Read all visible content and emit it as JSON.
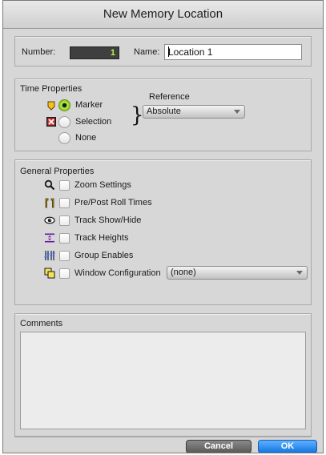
{
  "window": {
    "title": "New Memory Location"
  },
  "header": {
    "number_label": "Number:",
    "number_value": "1",
    "name_label": "Name:",
    "name_value": "Location 1"
  },
  "time_properties": {
    "title": "Time Properties",
    "options": [
      {
        "label": "Marker",
        "selected": true,
        "icon": "marker-icon"
      },
      {
        "label": "Selection",
        "selected": false,
        "icon": "selection-icon"
      },
      {
        "label": "None",
        "selected": false,
        "icon": ""
      }
    ],
    "reference_label": "Reference",
    "reference_value": "Absolute"
  },
  "general_properties": {
    "title": "General Properties",
    "items": [
      {
        "label": "Zoom Settings",
        "icon": "magnifier-icon",
        "checked": false
      },
      {
        "label": "Pre/Post Roll Times",
        "icon": "pre-post-roll-icon",
        "checked": false
      },
      {
        "label": "Track Show/Hide",
        "icon": "eye-icon",
        "checked": false
      },
      {
        "label": "Track Heights",
        "icon": "track-heights-icon",
        "checked": false
      },
      {
        "label": "Group Enables",
        "icon": "group-enables-icon",
        "checked": false
      },
      {
        "label": "Window Configuration",
        "icon": "window-config-icon",
        "checked": false
      }
    ],
    "window_config_value": "(none)"
  },
  "comments": {
    "title": "Comments",
    "value": ""
  },
  "buttons": {
    "cancel": "Cancel",
    "ok": "OK"
  },
  "colors": {
    "ok_button": "#1477e0",
    "number_text": "#b6f04a",
    "radio_selected": "#8ccb1c"
  }
}
